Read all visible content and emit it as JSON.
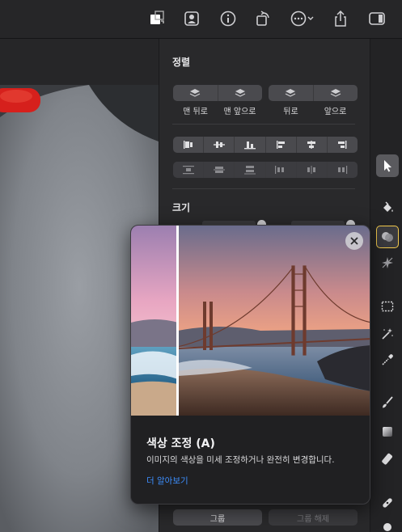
{
  "inspector": {
    "arrange_title": "정렬",
    "arrange_labels": [
      "맨 뒤로",
      "맨 앞으로",
      "뒤로",
      "앞으로"
    ],
    "size_title": "크기",
    "group_label": "그룹",
    "ungroup_label": "그룹 해제"
  },
  "popover": {
    "title": "색상 조정 (A)",
    "description": "이미지의 색상을 미세 조정하거나 완전히 변경합니다.",
    "learn_more": "더 알아보기"
  },
  "colors": {
    "accent": "#f2c94c",
    "link": "#3d8fff",
    "panel": "#29292b"
  },
  "icons": {
    "toolbar": [
      "swap-colors-icon",
      "person-icon",
      "info-icon",
      "rotate-icon",
      "more-icon",
      "share-icon",
      "sidebar-icon"
    ],
    "tools": [
      "arrow-select-icon",
      "paint-bucket-icon",
      "color-adjust-icon",
      "sparkle-icon",
      "rect-select-icon",
      "magic-wand-icon",
      "eyedropper-icon",
      "brush-icon",
      "gradient-icon",
      "eraser-icon",
      "bandage-icon"
    ]
  }
}
